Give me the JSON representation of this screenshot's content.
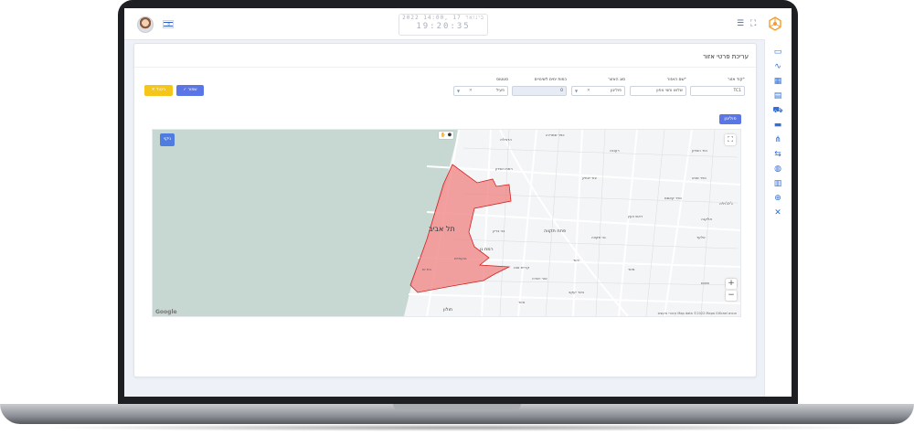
{
  "header": {
    "date": "2022 בינואר 17 ,14:00",
    "time": "19:20:35"
  },
  "form": {
    "title": "עריכת פרטי אזור",
    "fields": [
      {
        "label": "קוד אזור",
        "value": "TC1",
        "required": true
      },
      {
        "label": "שם האזור",
        "value": "שלוש וחצי צפון",
        "required": true
      },
      {
        "label": "סוג האזור",
        "value": "פוליגון"
      },
      {
        "label": "כמות ימים לשינויים",
        "value": "0"
      },
      {
        "label": "סטטוס",
        "value": "פעיל"
      }
    ],
    "save_label": "שמור",
    "cancel_label": "ביטול",
    "polygon_label": "פוליגון"
  },
  "map": {
    "clean_label": "ניקוי",
    "big_city": "תל אביב",
    "labels": [
      {
        "text": "כפר שמריהו"
      },
      {
        "text": "רעננה"
      },
      {
        "text": "הוד השרון"
      },
      {
        "text": "כפר סבא"
      },
      {
        "text": "הרצליה"
      },
      {
        "text": "רמת השרון"
      },
      {
        "text": "פתח תקווה"
      },
      {
        "text": "רמת גן"
      },
      {
        "text": "בני ברק"
      },
      {
        "text": "גבעתיים"
      },
      {
        "text": "חולון"
      },
      {
        "text": "ראש העין"
      },
      {
        "text": "אלעד"
      },
      {
        "text": "קריית אונו"
      },
      {
        "text": "אור יהודה"
      },
      {
        "text": "יהוד"
      },
      {
        "text": "בת ים"
      },
      {
        "text": "שוהם"
      },
      {
        "text": "אזור"
      },
      {
        "text": "גני תקווה"
      },
      {
        "text": "כפר קאסם"
      },
      {
        "text": "אלקנה"
      },
      {
        "text": "ג'לג'וליה"
      },
      {
        "text": "צור יצחק"
      },
      {
        "text": "מזור"
      },
      {
        "text": "באר יעקב"
      }
    ],
    "attribution": "קיצורי מקשים  Map data ©2022 Mapa GISrael  תנאים",
    "google": "Google"
  },
  "colors": {
    "polygon_fill": "#f08080",
    "polygon_stroke": "#d62020",
    "sea": "#c7d7d2",
    "primary": "#5a76e6",
    "warning": "#f5c518"
  }
}
